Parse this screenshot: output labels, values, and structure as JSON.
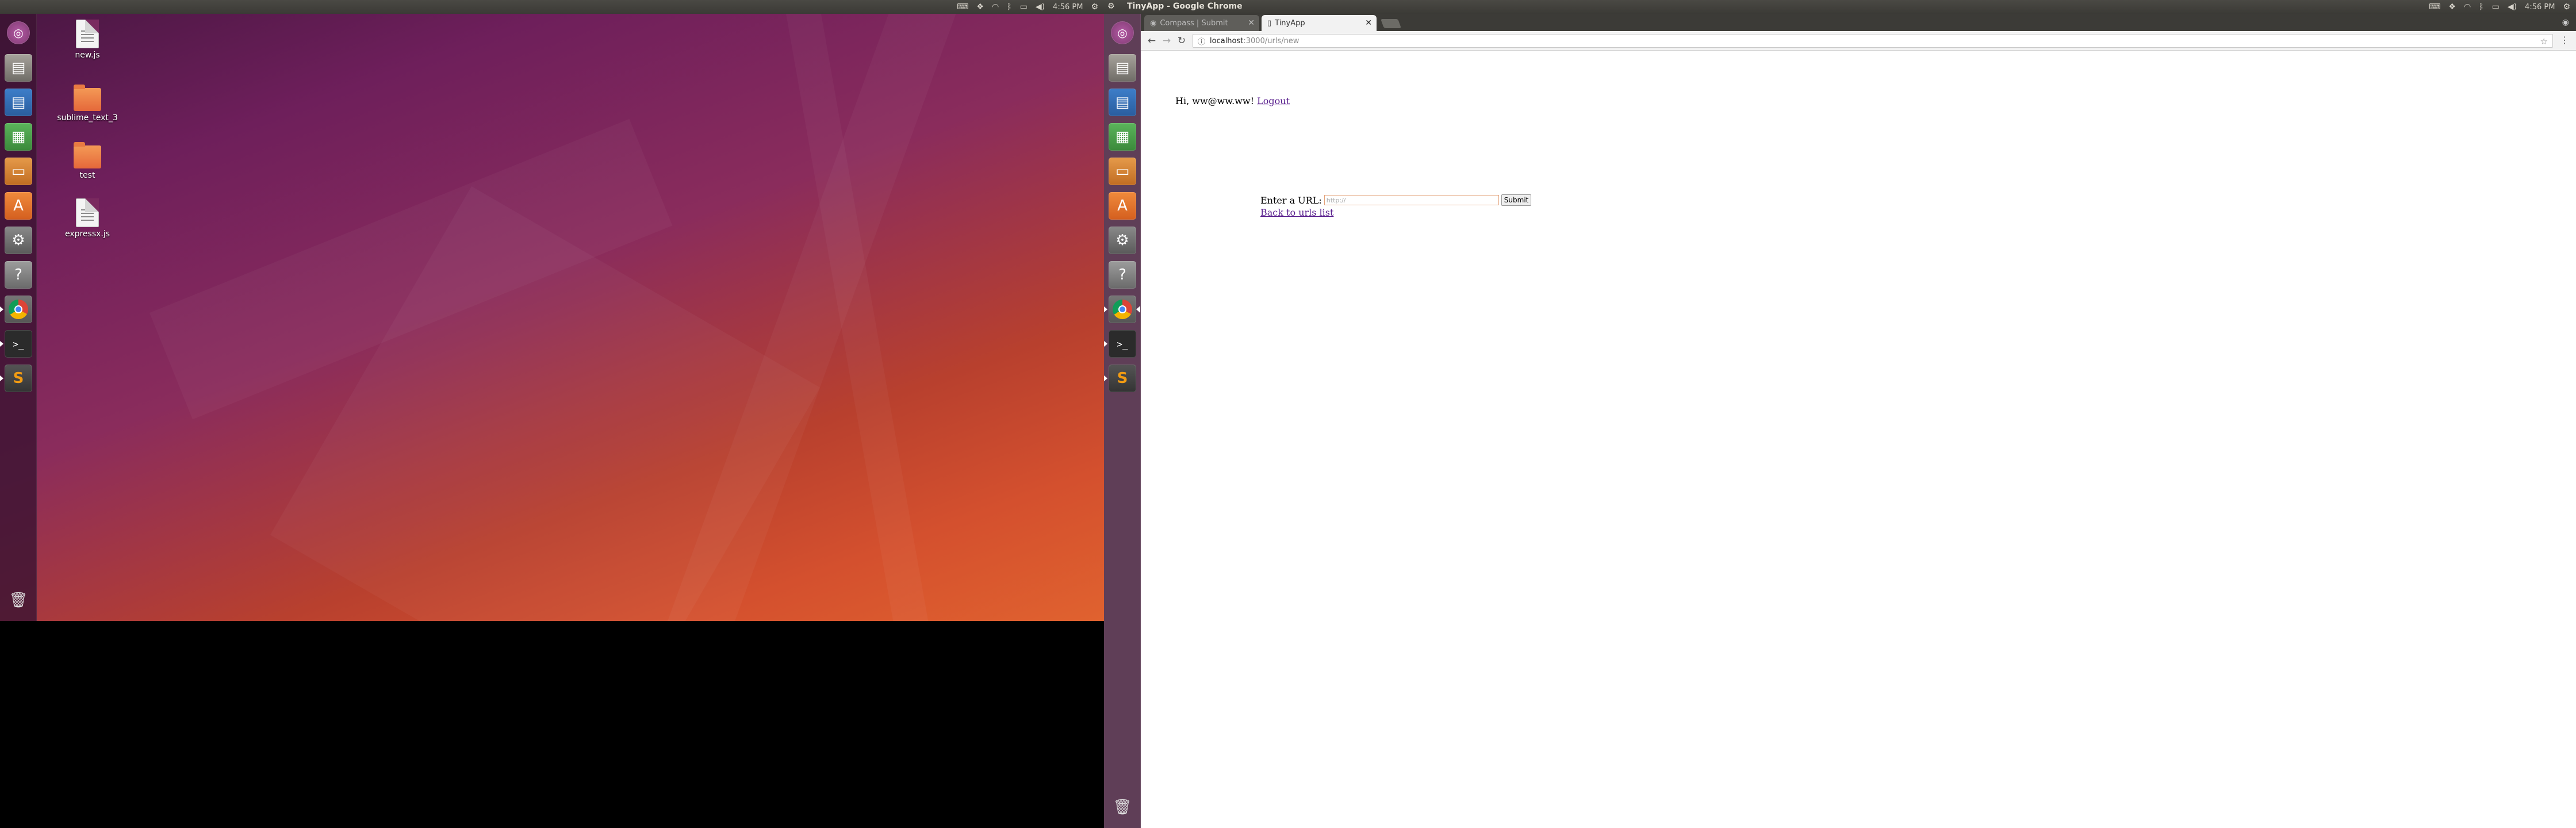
{
  "left_screen": {
    "panel": {
      "time": "4:56 PM"
    },
    "desktop_icons": [
      {
        "label": "new.js",
        "kind": "file"
      },
      {
        "label": "sublime_text_3",
        "kind": "folder"
      },
      {
        "label": "test",
        "kind": "folder"
      },
      {
        "label": "expressx.js",
        "kind": "file"
      }
    ],
    "launcher": [
      "dash-icon",
      "files-icon",
      "libreoffice-writer-icon",
      "libreoffice-calc-icon",
      "libreoffice-impress-icon",
      "software-center-icon",
      "system-settings-icon",
      "help-icon",
      "chrome-icon",
      "terminal-icon",
      "sublime-text-icon",
      "trash-icon"
    ]
  },
  "right_screen": {
    "panel": {
      "window_title": "TinyApp - Google Chrome",
      "time": "4:56 PM"
    },
    "browser": {
      "tabs": [
        {
          "label": "Compass | Submit",
          "active": false
        },
        {
          "label": "TinyApp",
          "active": true
        }
      ],
      "address": {
        "host": "localhost",
        "path": ":3000/urls/new"
      }
    },
    "page": {
      "greeting": "Hi, ww@ww.ww!",
      "logout_label": "Logout",
      "form_label": "Enter a URL:",
      "url_placeholder": "http://",
      "submit_label": "Submit",
      "back_link": "Back to urls list"
    }
  },
  "colors": {
    "panel": "#3c3b37",
    "launcher": "#3c1432",
    "link": "#551a8b"
  }
}
